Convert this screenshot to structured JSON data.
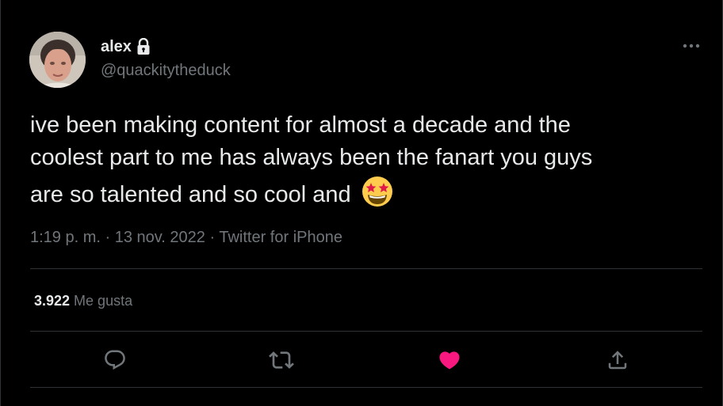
{
  "author": {
    "display_name": "alex",
    "handle": "@quackitytheduck",
    "protected_icon": "lock-icon",
    "avatar": "profile-photo"
  },
  "tweet": {
    "lines": [
      "ive been making content for almost a decade and the",
      "coolest part to me has always been the fanart you guys",
      "are so talented and so cool and"
    ],
    "emoji": "star-struck-emoji"
  },
  "meta": {
    "time": "1:19 p. m.",
    "separator": "·",
    "date": "13 nov. 2022",
    "source": "Twitter for iPhone"
  },
  "stats": {
    "likes_count": "3.922",
    "likes_label": "Me gusta"
  },
  "actions": [
    {
      "name": "reply",
      "icon": "reply-icon"
    },
    {
      "name": "retweet",
      "icon": "retweet-icon"
    },
    {
      "name": "like",
      "icon": "heart-icon",
      "active": true
    },
    {
      "name": "share",
      "icon": "share-icon"
    }
  ],
  "colors": {
    "background": "#000000",
    "text_primary": "#e7e9ea",
    "text_secondary": "#71767b",
    "divider": "#2f3336",
    "like_active": "#f91880"
  }
}
